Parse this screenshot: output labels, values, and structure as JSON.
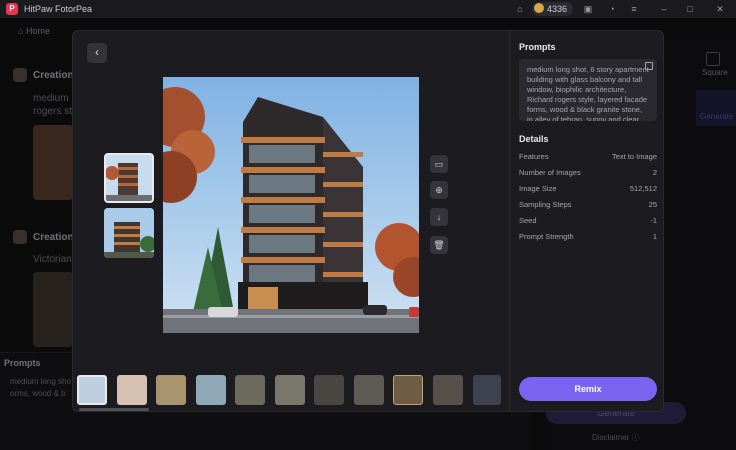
{
  "app": {
    "title": "HitPaw FotorPea"
  },
  "titlebar": {
    "credits": "4336"
  },
  "nav": {
    "home": "Home"
  },
  "background": {
    "creation1_title": "Creation",
    "creation1_text": "medium",
    "creation1_text2": "rogers st",
    "creation2_title": "Creation",
    "creation2_text": "Victorian",
    "prompts_label": "Prompts",
    "prompts_text1": "medium long sho",
    "prompts_text2": "orms, wood & b",
    "right_square": "Square",
    "right_generate": "Generate",
    "generate_btn": "Generate",
    "disclaimer": "Disclaimer"
  },
  "modal": {
    "back_icon": "chevron-left-icon",
    "tools": [
      "image-edit-icon",
      "zoom-in-icon",
      "download-icon",
      "delete-icon"
    ],
    "prompts_title": "Prompts",
    "prompt_text": "medium long shot, 6 story apartment building with glass balcony and tall window, biophilic architecture, Richard rogers style, layered facade forms, wood & black granite stone, in alley of tehran, sunny and clear sky",
    "details_title": "Details",
    "details": [
      {
        "label": "Features",
        "value": "Text to Image"
      },
      {
        "label": "Number of Images",
        "value": "2"
      },
      {
        "label": "Image Size",
        "value": "512,512"
      },
      {
        "label": "Sampling Steps",
        "value": "25"
      },
      {
        "label": "Seed",
        "value": "-1"
      },
      {
        "label": "Prompt Strength",
        "value": "1"
      }
    ],
    "remix_label": "Remix"
  }
}
